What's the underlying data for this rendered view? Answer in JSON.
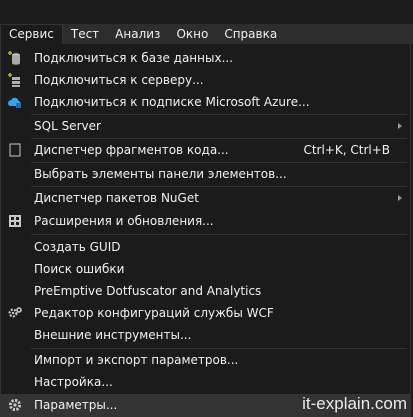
{
  "menubar": {
    "items": [
      {
        "label": "Сервис"
      },
      {
        "label": "Тест"
      },
      {
        "label": "Анализ"
      },
      {
        "label": "Окно"
      },
      {
        "label": "Справка"
      }
    ]
  },
  "menu": {
    "items": [
      {
        "label": "Подключиться к базе данных...",
        "icon": "add-database-icon"
      },
      {
        "label": "Подключиться к серверу...",
        "icon": "add-server-icon"
      },
      {
        "label": "Подключиться к подписке Microsoft Azure...",
        "icon": "azure-cloud-icon"
      },
      {
        "label": "SQL Server",
        "submenu": true
      },
      {
        "label": "Диспетчер фрагментов кода...",
        "shortcut": "Ctrl+K, Ctrl+B",
        "icon": "snippet-icon"
      },
      {
        "label": "Выбрать элементы панели элементов..."
      },
      {
        "label": "Диспетчер пакетов NuGet",
        "submenu": true
      },
      {
        "label": "Расширения и обновления...",
        "icon": "extensions-icon"
      },
      {
        "label": "Создать GUID"
      },
      {
        "label": "Поиск ошибки"
      },
      {
        "label": "PreEmptive Dotfuscator and Analytics"
      },
      {
        "label": "Редактор конфигураций службы WCF",
        "icon": "wcf-gears-icon"
      },
      {
        "label": "Внешние инструменты..."
      },
      {
        "label": "Импорт и экспорт параметров..."
      },
      {
        "label": "Настройка..."
      },
      {
        "label": "Параметры...",
        "icon": "gear-icon"
      }
    ]
  },
  "watermark": "it-explain.com",
  "colors": {
    "background": "#1b1b1c",
    "menubar": "#2d2d30",
    "hover": "#333334",
    "separator": "#333337",
    "text": "#f1f1f1"
  }
}
